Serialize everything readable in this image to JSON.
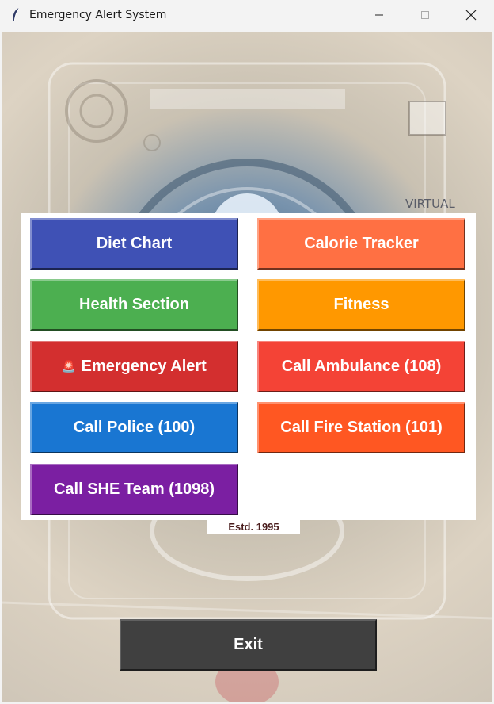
{
  "window": {
    "title": "Emergency Alert System",
    "controls": {
      "minimize": "minimize-icon",
      "maximize": "maximize-icon",
      "close": "close-icon"
    }
  },
  "background": {
    "label_virtual": "VIRTUAL",
    "estd_text": "Estd. 1995"
  },
  "buttons": [
    {
      "label": "Diet Chart",
      "color": "#3F51B5"
    },
    {
      "label": "Calorie Tracker",
      "color": "#FF7043"
    },
    {
      "label": "Health Section",
      "color": "#4CAF50"
    },
    {
      "label": "Fitness",
      "color": "#FF9800"
    },
    {
      "label": "Emergency Alert",
      "emoji": "🚨",
      "color": "#D32F2F"
    },
    {
      "label": "Call Ambulance (108)",
      "color": "#F44336"
    },
    {
      "label": "Call Police (100)",
      "color": "#1976D2"
    },
    {
      "label": "Call Fire Station (101)",
      "color": "#FF5722"
    },
    {
      "label": "Call SHE Team (1098)",
      "color": "#7B1FA2"
    }
  ],
  "exit": {
    "label": "Exit",
    "color": "#404040"
  }
}
